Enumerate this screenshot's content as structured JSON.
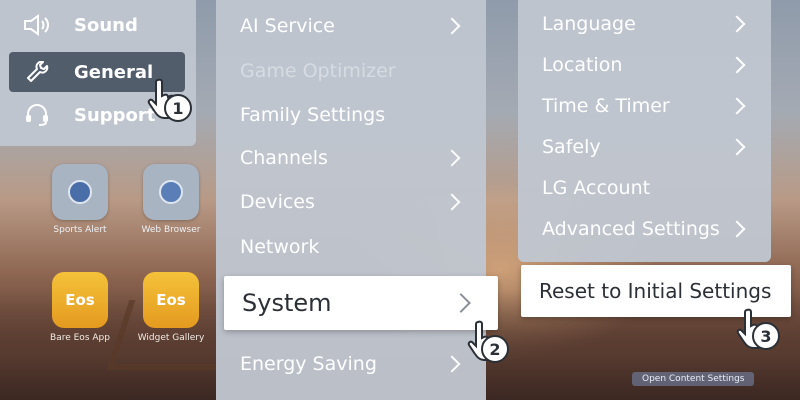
{
  "background": {
    "tiles": [
      {
        "caption": "Sports Alert"
      },
      {
        "caption": "Web Browser"
      }
    ],
    "eos_tiles": [
      {
        "logo": "Eos",
        "caption": "Bare Eos App"
      },
      {
        "logo": "Eos",
        "caption": "Widget Gallery"
      }
    ],
    "footer_button": "Open Content Settings"
  },
  "main_menu": {
    "items": [
      {
        "label": "Sound",
        "icon": "speaker-icon"
      },
      {
        "label": "General",
        "icon": "wrench-icon",
        "selected": true
      },
      {
        "label": "Support",
        "icon": "headset-icon"
      }
    ]
  },
  "general_menu": {
    "items": [
      {
        "label": "AI Service",
        "has_submenu": true
      },
      {
        "label": "Game Optimizer",
        "disabled": true
      },
      {
        "label": "Family Settings"
      },
      {
        "label": "Channels",
        "has_submenu": true
      },
      {
        "label": "Devices",
        "has_submenu": true
      },
      {
        "label": "Network"
      },
      {
        "label": "System",
        "has_submenu": true,
        "selected": true
      },
      {
        "label": "Energy Saving",
        "has_submenu": true
      }
    ]
  },
  "system_menu": {
    "items": [
      {
        "label": "Language",
        "has_submenu": true
      },
      {
        "label": "Location",
        "has_submenu": true
      },
      {
        "label": "Time & Timer",
        "has_submenu": true
      },
      {
        "label": "Safely",
        "has_submenu": true
      },
      {
        "label": "LG Account"
      },
      {
        "label": "Advanced Settings",
        "has_submenu": true
      },
      {
        "label": "Reset to Initial Settings",
        "selected": true
      }
    ]
  },
  "steps": [
    "1",
    "2",
    "3"
  ],
  "colors": {
    "panel": "#c0c6cf",
    "highlight": "#ffffff",
    "selected_main": "#3f4a5a",
    "text_light": "#ffffff",
    "text_dark": "#2b2f36"
  }
}
